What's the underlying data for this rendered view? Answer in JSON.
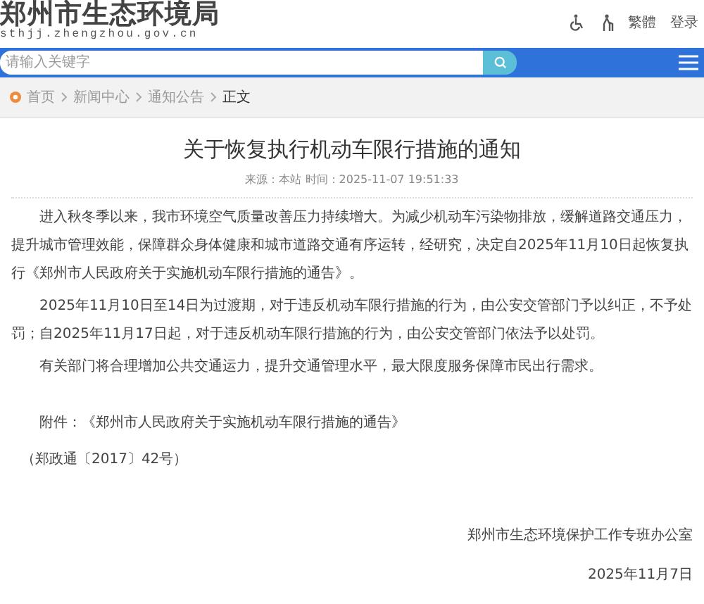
{
  "header": {
    "site_name": "郑州市生态环境局",
    "domain": "sthjj.zhengzhou.gov.cn",
    "links": [
      "繁體",
      "登录"
    ]
  },
  "search": {
    "placeholder": "请输入关键字"
  },
  "breadcrumb": [
    {
      "label": "首页",
      "current": false
    },
    {
      "label": "新闻中心",
      "current": false
    },
    {
      "label": "通知公告",
      "current": false
    },
    {
      "label": "正文",
      "current": true
    }
  ],
  "article": {
    "title": "关于恢复执行机动车限行措施的通知",
    "meta": "来源：本站 时间：2025-11-07 19:51:33",
    "paragraphs": [
      "进入秋冬季以来，我市环境空气质量改善压力持续增大。为减少机动车污染物排放，缓解道路交通压力，提升城市管理效能，保障群众身体健康和城市道路交通有序运转，经研究，决定自2025年11月10日起恢复执行《郑州市人民政府关于实施机动车限行措施的通告》。",
      "2025年11月10日至14日为过渡期，对于违反机动车限行措施的行为，由公安交管部门予以纠正，不予处罚；自2025年11月17日起，对于违反机动车限行措施的行为，由公安交管部门依法予以处罚。",
      "有关部门将合理增加公共交通运力，提升交通管理水平，最大限度服务保障市民出行需求。"
    ],
    "attachment": "附件：《郑州市人民政府关于实施机动车限行措施的通告》",
    "attachment_ref": "（郑政通〔2017〕42号）",
    "signature": "郑州市生态环境保护工作专班办公室",
    "date": "2025年11月7日"
  }
}
